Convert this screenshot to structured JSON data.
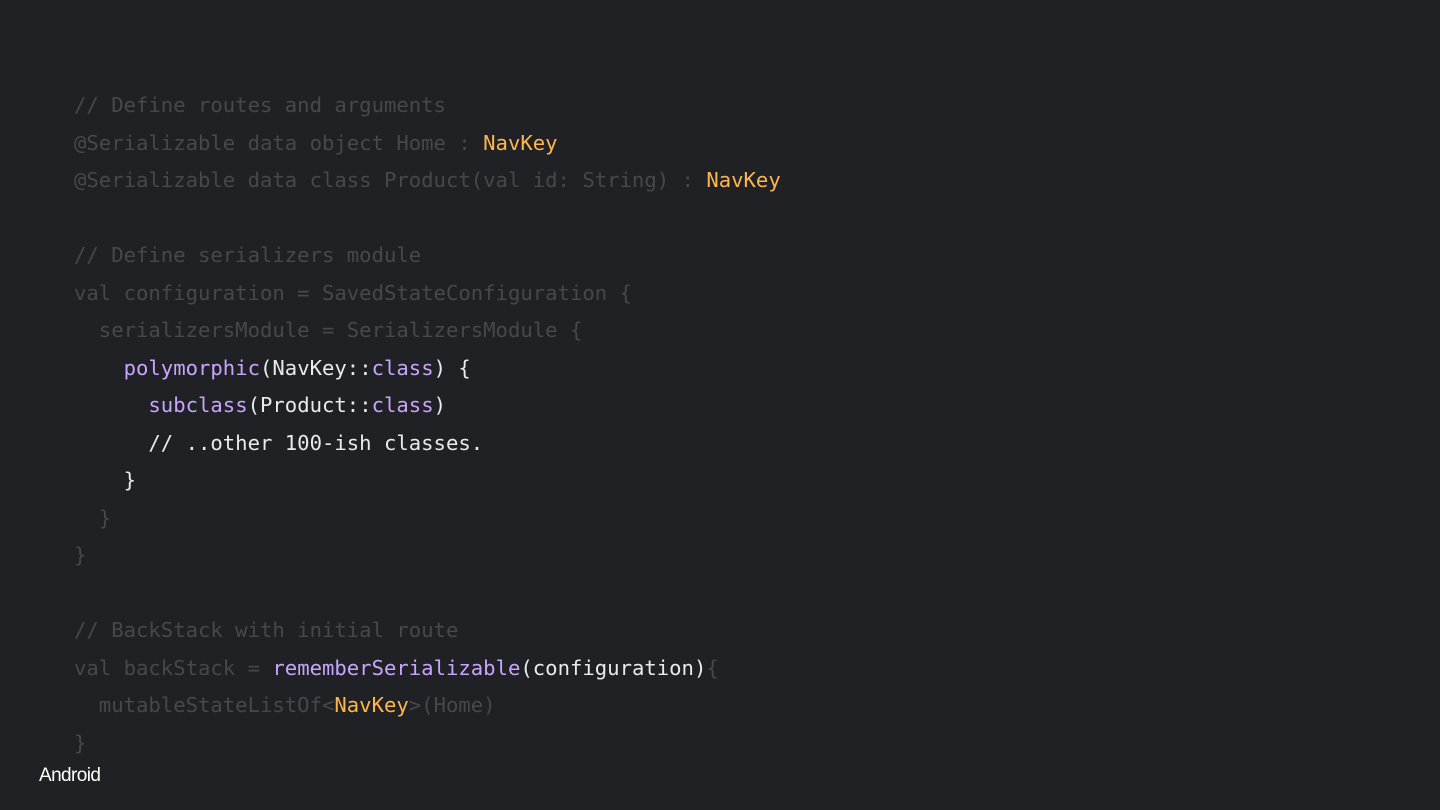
{
  "colors": {
    "background": "#202124",
    "dim": "#47484c",
    "text": "#e8eaed",
    "keyword": "#c9a4ff",
    "type": "#fdb64f",
    "logo": "#ffffff"
  },
  "code": {
    "lines": [
      [
        {
          "t": "// Define routes and arguments",
          "c": "dim"
        }
      ],
      [
        {
          "t": "@Serializable data object Home : ",
          "c": "dim"
        },
        {
          "t": "NavKey",
          "c": "type"
        }
      ],
      [
        {
          "t": "@Serializable data class Product(val id: String) : ",
          "c": "dim"
        },
        {
          "t": "NavKey",
          "c": "type"
        }
      ],
      [],
      [
        {
          "t": "// Define serializers module",
          "c": "dim"
        }
      ],
      [
        {
          "t": "val configuration = SavedStateConfiguration {",
          "c": "dim"
        }
      ],
      [
        {
          "t": "  serializersModule = SerializersModule {",
          "c": "dim"
        }
      ],
      [
        {
          "t": "    ",
          "c": "text"
        },
        {
          "t": "polymorphic",
          "c": "keyword"
        },
        {
          "t": "(NavKey::",
          "c": "text"
        },
        {
          "t": "class",
          "c": "keyword"
        },
        {
          "t": ") {",
          "c": "text"
        }
      ],
      [
        {
          "t": "      ",
          "c": "text"
        },
        {
          "t": "subclass",
          "c": "keyword"
        },
        {
          "t": "(Product::",
          "c": "text"
        },
        {
          "t": "class",
          "c": "keyword"
        },
        {
          "t": ")",
          "c": "text"
        }
      ],
      [
        {
          "t": "      // ..other 100-ish classes.",
          "c": "text"
        }
      ],
      [
        {
          "t": "    }",
          "c": "text"
        }
      ],
      [
        {
          "t": "  }",
          "c": "dim"
        }
      ],
      [
        {
          "t": "}",
          "c": "dim"
        }
      ],
      [],
      [
        {
          "t": "// BackStack with initial route",
          "c": "dim"
        }
      ],
      [
        {
          "t": "val backStack = ",
          "c": "dim"
        },
        {
          "t": "rememberSerializable",
          "c": "keyword"
        },
        {
          "t": "(configuration)",
          "c": "text"
        },
        {
          "t": "{",
          "c": "dim"
        }
      ],
      [
        {
          "t": "  mutableStateListOf<",
          "c": "dim"
        },
        {
          "t": "NavKey",
          "c": "type"
        },
        {
          "t": ">(Home)",
          "c": "dim"
        }
      ],
      [
        {
          "t": "}",
          "c": "dim"
        }
      ]
    ]
  },
  "brand": {
    "logo_text": "Android"
  }
}
